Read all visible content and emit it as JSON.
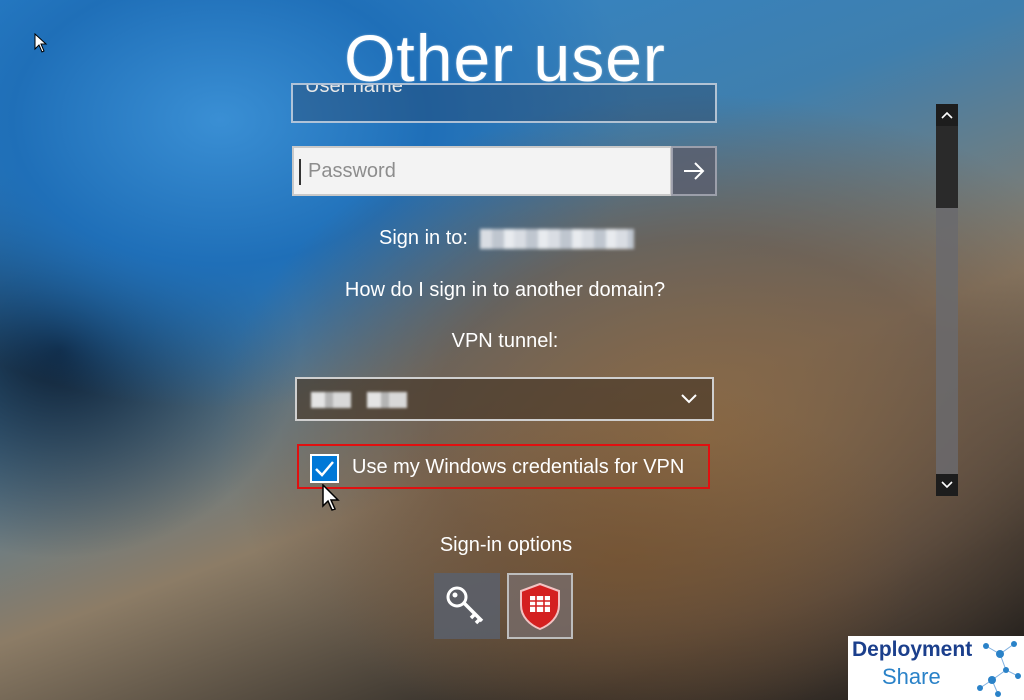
{
  "login": {
    "title": "Other user",
    "username_placeholder": "User name",
    "password_placeholder": "Password",
    "sign_in_to_label": "Sign in to:",
    "domain_help_link": "How do I sign in to another domain?",
    "vpn_label": "VPN tunnel:",
    "vpn_checkbox_label": "Use my Windows credentials for VPN",
    "vpn_checkbox_checked": true,
    "signin_options_label": "Sign-in options"
  },
  "colors": {
    "checkbox_accent": "#0078d7",
    "highlight_box": "#e01010"
  },
  "icons": {
    "submit": "arrow-right-icon",
    "dropdown": "chevron-down-icon",
    "option_1": "key-icon",
    "option_2": "shield-icon"
  },
  "watermark": {
    "line1": "Deployment",
    "line2": "Share"
  }
}
